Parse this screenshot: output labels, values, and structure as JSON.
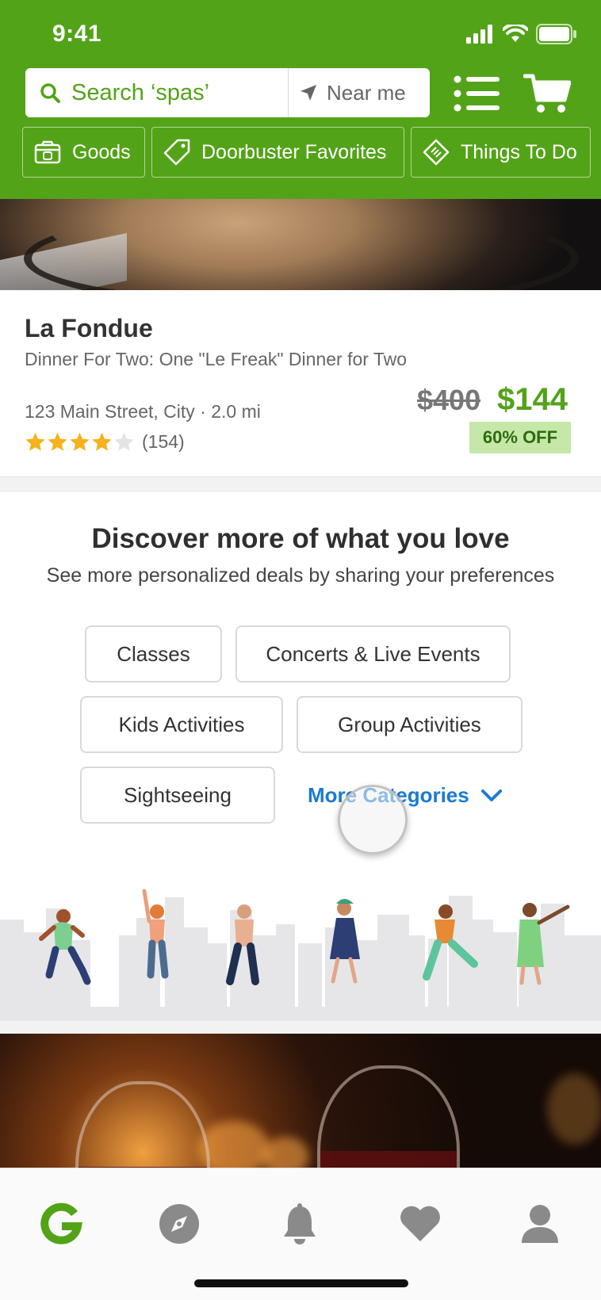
{
  "status_bar": {
    "time": "9:41"
  },
  "header": {
    "search_placeholder": "Search ‘spas’",
    "near_me": "Near me",
    "chips": [
      {
        "label": "Goods"
      },
      {
        "label": "Doorbuster Favorites"
      },
      {
        "label": "Things To Do"
      }
    ]
  },
  "deal": {
    "title": "La Fondue",
    "subtitle": "Dinner For Two: One \"Le Freak\" Dinner for Two",
    "address": "123 Main Street, City · 2.0 mi",
    "rating": 4,
    "rating_max": 5,
    "rating_count": "(154)",
    "price_original": "$400",
    "price_sale": "$144",
    "discount": "60% OFF"
  },
  "discover": {
    "title": "Discover more of what you love",
    "subtitle": "See more personalized deals by sharing your preferences",
    "categories": [
      {
        "label": "Classes"
      },
      {
        "label": "Concerts & Live Events"
      },
      {
        "label": "Kids Activities"
      },
      {
        "label": "Group Activities"
      },
      {
        "label": "Sightseeing"
      }
    ],
    "more_label": "More Categories"
  },
  "tabbar": {
    "items": [
      {
        "icon": "groupon-g-icon",
        "active": true
      },
      {
        "icon": "compass-icon",
        "active": false
      },
      {
        "icon": "bell-icon",
        "active": false
      },
      {
        "icon": "heart-icon",
        "active": false
      },
      {
        "icon": "profile-icon",
        "active": false
      }
    ]
  },
  "colors": {
    "brand_green": "#53a318",
    "link_blue": "#1a7bd3",
    "star_gold": "#f5b21b",
    "discount_bg": "#c5e8a9"
  }
}
